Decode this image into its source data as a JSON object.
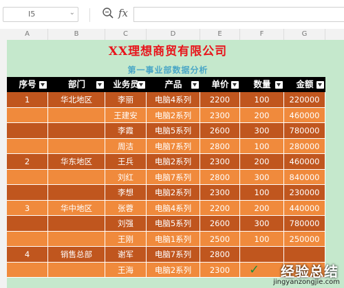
{
  "formula_bar": {
    "cell_ref": "I5",
    "fx_label": "fx",
    "formula_value": ""
  },
  "columns": [
    "A",
    "B",
    "C",
    "D",
    "E",
    "F",
    "G"
  ],
  "sheet": {
    "title": "XX理想商贸有限公司",
    "subtitle": "第一事业部数据分析"
  },
  "table": {
    "headers": [
      "序号",
      "部门",
      "业务员",
      "产品",
      "单价",
      "数量",
      "金额"
    ],
    "rows": [
      [
        "1",
        "华北地区",
        "李丽",
        "电脑4系列",
        "2200",
        "100",
        "220000"
      ],
      [
        "",
        "",
        "王建安",
        "电脑2系列",
        "2300",
        "200",
        "460000"
      ],
      [
        "",
        "",
        "李霞",
        "电脑5系列",
        "2600",
        "300",
        "780000"
      ],
      [
        "",
        "",
        "周洁",
        "电脑7系列",
        "2800",
        "100",
        "280000"
      ],
      [
        "2",
        "华东地区",
        "王兵",
        "电脑2系列",
        "2300",
        "200",
        "460000"
      ],
      [
        "",
        "",
        "刘红",
        "电脑7系列",
        "2800",
        "300",
        "840000"
      ],
      [
        "",
        "",
        "李想",
        "电脑2系列",
        "2300",
        "100",
        "230000"
      ],
      [
        "3",
        "华中地区",
        "张蓉",
        "电脑4系列",
        "2200",
        "200",
        "440000"
      ],
      [
        "",
        "",
        "刘强",
        "电脑5系列",
        "2600",
        "300",
        "780000"
      ],
      [
        "",
        "",
        "王刚",
        "电脑1系列",
        "2500",
        "100",
        "250000"
      ],
      [
        "4",
        "销售总部",
        "谢军",
        "电脑7系列",
        "2800",
        "",
        ""
      ],
      [
        "",
        "",
        "王海",
        "电脑2系列",
        "2300",
        "",
        ""
      ]
    ]
  },
  "colors": {
    "header_bg": "#000000",
    "row_dark": "#c0561e",
    "row_light": "#f08a3c",
    "title": "#e8141b",
    "subtitle": "#4aa7c6",
    "sheet_bg": "#c5e8cc"
  },
  "watermark": {
    "text": "经验总结",
    "url": "jingyanzongjie.com"
  }
}
